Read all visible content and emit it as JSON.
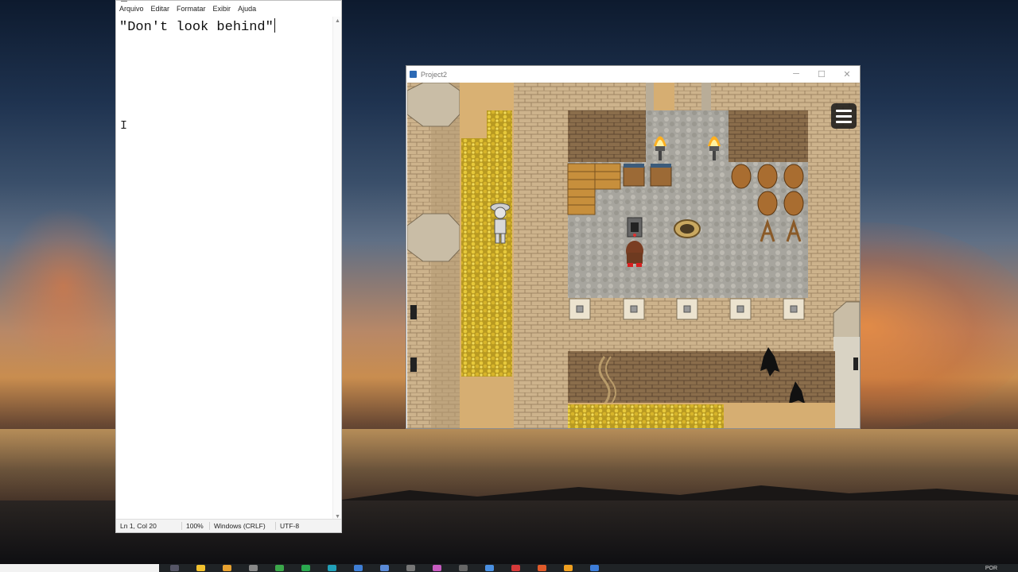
{
  "notepad": {
    "menu": [
      "Arquivo",
      "Editar",
      "Formatar",
      "Exibir",
      "Ajuda"
    ],
    "text": "\"Don't look behind\"",
    "status": {
      "position": "Ln 1, Col 20",
      "zoom": "100%",
      "line_ending": "Windows (CRLF)",
      "encoding": "UTF-8"
    }
  },
  "game": {
    "title": "Project2",
    "window_controls": [
      "─",
      "☐",
      "✕"
    ]
  },
  "taskbar": {
    "language": "POR"
  },
  "icons": {
    "menu": "hamburger-menu-icon",
    "app": "rpg-maker-app-icon",
    "cursor": "text-cursor-icon"
  }
}
